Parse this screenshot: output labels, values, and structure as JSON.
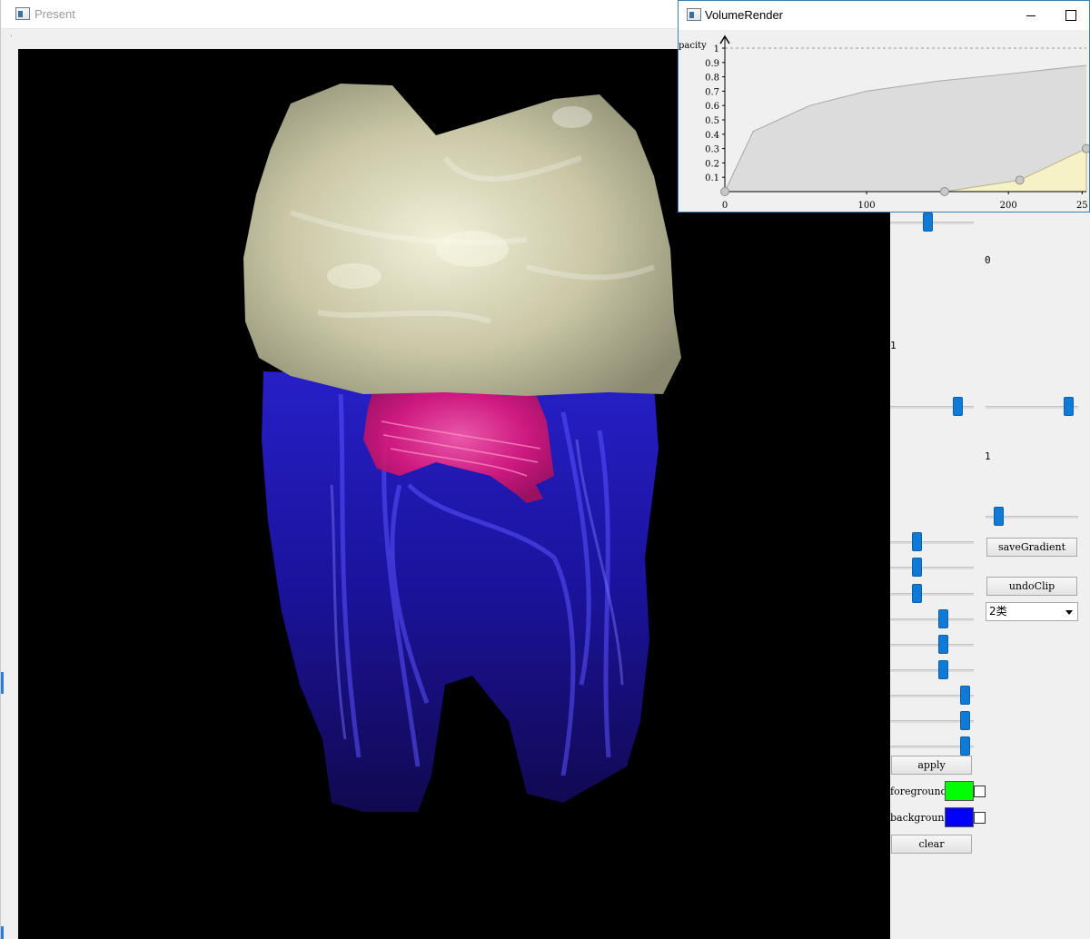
{
  "present_window": {
    "title": "Present",
    "dot": "."
  },
  "volume_window": {
    "title": "VolumeRender",
    "chart": {
      "ylabel": "pacity",
      "y_ticks": [
        "1",
        "0.9",
        "0.8",
        "0.7",
        "0.6",
        "0.5",
        "0.4",
        "0.3",
        "0.2",
        "0.1"
      ],
      "x_ticks": [
        "0",
        "100",
        "200",
        "25"
      ]
    }
  },
  "chart_data": {
    "type": "line",
    "xlabel": "",
    "ylabel": "pacity",
    "xlim": [
      0,
      255
    ],
    "ylim": [
      0,
      1
    ],
    "grid": false,
    "reference_line": 1,
    "series": [
      {
        "x": [
          0,
          20,
          60,
          100,
          150,
          200,
          255
        ],
        "y": [
          0,
          0.42,
          0.6,
          0.7,
          0.77,
          0.82,
          0.88
        ]
      },
      {
        "x": [
          0,
          155,
          208,
          255
        ],
        "y": [
          0,
          0,
          0.08,
          0.3
        ]
      }
    ],
    "control_points": [
      [
        0,
        0
      ],
      [
        155,
        0
      ],
      [
        208,
        0.08
      ],
      [
        255,
        0.3
      ]
    ]
  },
  "controls": {
    "value_0": "0",
    "value_1_left": "1",
    "value_1_right": "1",
    "save_gradient": "saveGradient",
    "undo_clip": "undoClip",
    "class_select": "2类",
    "apply": "apply",
    "foreground": "foreground",
    "background": "background",
    "clear": "clear",
    "colors": {
      "foreground": "#00ff00",
      "background": "#0000ff"
    },
    "slider_levels": [
      0.45,
      0.85,
      0.95,
      0.1,
      0.3,
      0.3,
      0.3,
      0.65,
      0.66,
      0.66,
      0.95,
      0.95,
      0.95
    ]
  }
}
